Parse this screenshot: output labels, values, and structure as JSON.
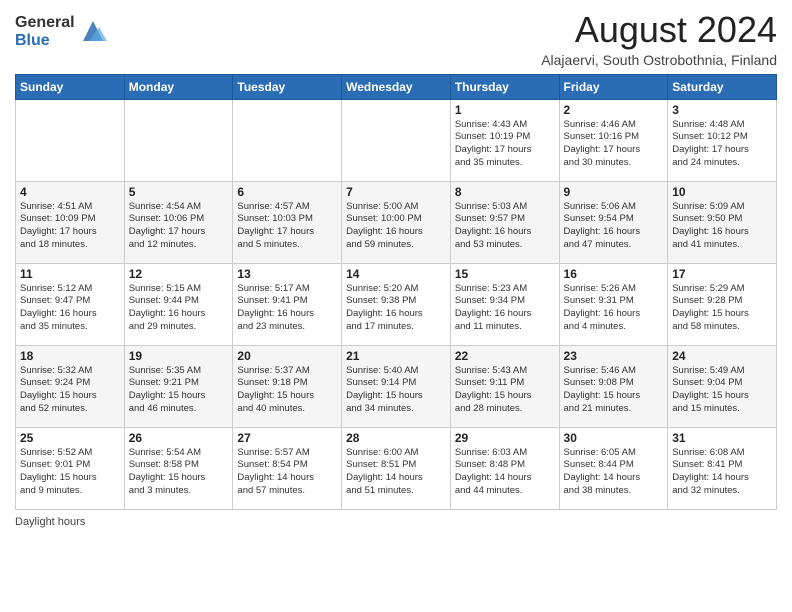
{
  "header": {
    "logo_line1": "General",
    "logo_line2": "Blue",
    "title": "August 2024",
    "subtitle": "Alajaervi, South Ostrobothnia, Finland"
  },
  "days_of_week": [
    "Sunday",
    "Monday",
    "Tuesday",
    "Wednesday",
    "Thursday",
    "Friday",
    "Saturday"
  ],
  "footer": {
    "label": "Daylight hours"
  },
  "weeks": [
    [
      {
        "day": "",
        "info": ""
      },
      {
        "day": "",
        "info": ""
      },
      {
        "day": "",
        "info": ""
      },
      {
        "day": "",
        "info": ""
      },
      {
        "day": "1",
        "info": "Sunrise: 4:43 AM\nSunset: 10:19 PM\nDaylight: 17 hours\nand 35 minutes."
      },
      {
        "day": "2",
        "info": "Sunrise: 4:46 AM\nSunset: 10:16 PM\nDaylight: 17 hours\nand 30 minutes."
      },
      {
        "day": "3",
        "info": "Sunrise: 4:48 AM\nSunset: 10:12 PM\nDaylight: 17 hours\nand 24 minutes."
      }
    ],
    [
      {
        "day": "4",
        "info": "Sunrise: 4:51 AM\nSunset: 10:09 PM\nDaylight: 17 hours\nand 18 minutes."
      },
      {
        "day": "5",
        "info": "Sunrise: 4:54 AM\nSunset: 10:06 PM\nDaylight: 17 hours\nand 12 minutes."
      },
      {
        "day": "6",
        "info": "Sunrise: 4:57 AM\nSunset: 10:03 PM\nDaylight: 17 hours\nand 5 minutes."
      },
      {
        "day": "7",
        "info": "Sunrise: 5:00 AM\nSunset: 10:00 PM\nDaylight: 16 hours\nand 59 minutes."
      },
      {
        "day": "8",
        "info": "Sunrise: 5:03 AM\nSunset: 9:57 PM\nDaylight: 16 hours\nand 53 minutes."
      },
      {
        "day": "9",
        "info": "Sunrise: 5:06 AM\nSunset: 9:54 PM\nDaylight: 16 hours\nand 47 minutes."
      },
      {
        "day": "10",
        "info": "Sunrise: 5:09 AM\nSunset: 9:50 PM\nDaylight: 16 hours\nand 41 minutes."
      }
    ],
    [
      {
        "day": "11",
        "info": "Sunrise: 5:12 AM\nSunset: 9:47 PM\nDaylight: 16 hours\nand 35 minutes."
      },
      {
        "day": "12",
        "info": "Sunrise: 5:15 AM\nSunset: 9:44 PM\nDaylight: 16 hours\nand 29 minutes."
      },
      {
        "day": "13",
        "info": "Sunrise: 5:17 AM\nSunset: 9:41 PM\nDaylight: 16 hours\nand 23 minutes."
      },
      {
        "day": "14",
        "info": "Sunrise: 5:20 AM\nSunset: 9:38 PM\nDaylight: 16 hours\nand 17 minutes."
      },
      {
        "day": "15",
        "info": "Sunrise: 5:23 AM\nSunset: 9:34 PM\nDaylight: 16 hours\nand 11 minutes."
      },
      {
        "day": "16",
        "info": "Sunrise: 5:26 AM\nSunset: 9:31 PM\nDaylight: 16 hours\nand 4 minutes."
      },
      {
        "day": "17",
        "info": "Sunrise: 5:29 AM\nSunset: 9:28 PM\nDaylight: 15 hours\nand 58 minutes."
      }
    ],
    [
      {
        "day": "18",
        "info": "Sunrise: 5:32 AM\nSunset: 9:24 PM\nDaylight: 15 hours\nand 52 minutes."
      },
      {
        "day": "19",
        "info": "Sunrise: 5:35 AM\nSunset: 9:21 PM\nDaylight: 15 hours\nand 46 minutes."
      },
      {
        "day": "20",
        "info": "Sunrise: 5:37 AM\nSunset: 9:18 PM\nDaylight: 15 hours\nand 40 minutes."
      },
      {
        "day": "21",
        "info": "Sunrise: 5:40 AM\nSunset: 9:14 PM\nDaylight: 15 hours\nand 34 minutes."
      },
      {
        "day": "22",
        "info": "Sunrise: 5:43 AM\nSunset: 9:11 PM\nDaylight: 15 hours\nand 28 minutes."
      },
      {
        "day": "23",
        "info": "Sunrise: 5:46 AM\nSunset: 9:08 PM\nDaylight: 15 hours\nand 21 minutes."
      },
      {
        "day": "24",
        "info": "Sunrise: 5:49 AM\nSunset: 9:04 PM\nDaylight: 15 hours\nand 15 minutes."
      }
    ],
    [
      {
        "day": "25",
        "info": "Sunrise: 5:52 AM\nSunset: 9:01 PM\nDaylight: 15 hours\nand 9 minutes."
      },
      {
        "day": "26",
        "info": "Sunrise: 5:54 AM\nSunset: 8:58 PM\nDaylight: 15 hours\nand 3 minutes."
      },
      {
        "day": "27",
        "info": "Sunrise: 5:57 AM\nSunset: 8:54 PM\nDaylight: 14 hours\nand 57 minutes."
      },
      {
        "day": "28",
        "info": "Sunrise: 6:00 AM\nSunset: 8:51 PM\nDaylight: 14 hours\nand 51 minutes."
      },
      {
        "day": "29",
        "info": "Sunrise: 6:03 AM\nSunset: 8:48 PM\nDaylight: 14 hours\nand 44 minutes."
      },
      {
        "day": "30",
        "info": "Sunrise: 6:05 AM\nSunset: 8:44 PM\nDaylight: 14 hours\nand 38 minutes."
      },
      {
        "day": "31",
        "info": "Sunrise: 6:08 AM\nSunset: 8:41 PM\nDaylight: 14 hours\nand 32 minutes."
      }
    ]
  ]
}
